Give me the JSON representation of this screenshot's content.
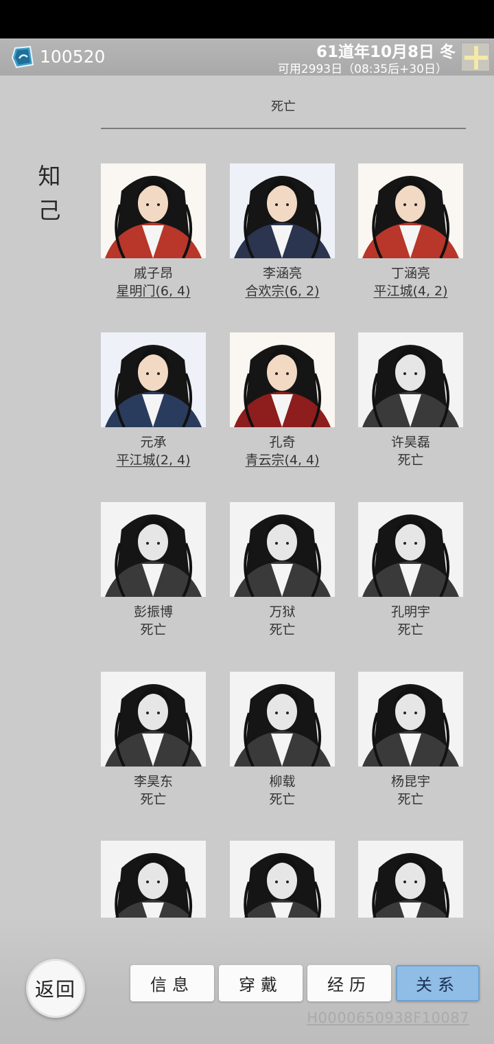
{
  "header": {
    "currency_icon": "spirit-stone-icon",
    "currency_value": "100520",
    "date": "61道年10月8日 冬",
    "available": "可用2993日（08:35后+30日）",
    "add_icon": "plus-icon"
  },
  "section": {
    "title": "死亡"
  },
  "side_label": {
    "line1": "知",
    "line2": "己"
  },
  "characters": [
    {
      "name": "戚子昂",
      "status": "星明门(6, 4)",
      "alive": true
    },
    {
      "name": "李涵亮",
      "status": "合欢宗(6, 2)",
      "alive": true
    },
    {
      "name": "丁涵亮",
      "status": "平江城(4, 2)",
      "alive": true
    },
    {
      "name": "元承",
      "status": "平江城(2, 4)",
      "alive": true
    },
    {
      "name": "孔奇",
      "status": "青云宗(4, 4)",
      "alive": true
    },
    {
      "name": "许昊磊",
      "status": "死亡",
      "alive": false
    },
    {
      "name": "彭振博",
      "status": "死亡",
      "alive": false
    },
    {
      "name": "万狱",
      "status": "死亡",
      "alive": false
    },
    {
      "name": "孔明宇",
      "status": "死亡",
      "alive": false
    },
    {
      "name": "李昊东",
      "status": "死亡",
      "alive": false
    },
    {
      "name": "柳载",
      "status": "死亡",
      "alive": false
    },
    {
      "name": "杨昆宇",
      "status": "死亡",
      "alive": false
    },
    {
      "name": "",
      "status": "",
      "alive": false
    },
    {
      "name": "",
      "status": "",
      "alive": false
    },
    {
      "name": "",
      "status": "",
      "alive": false
    }
  ],
  "footer": {
    "back_label": "返回",
    "tabs": [
      {
        "label": "信息",
        "active": false
      },
      {
        "label": "穿戴",
        "active": false
      },
      {
        "label": "经历",
        "active": false
      },
      {
        "label": "关系",
        "active": true
      }
    ],
    "build_id": "H0000650938F10087"
  },
  "colors": {
    "active_tab": "#8fbde5",
    "background": "#cbcbcb",
    "robe_red": "#b8362a"
  }
}
